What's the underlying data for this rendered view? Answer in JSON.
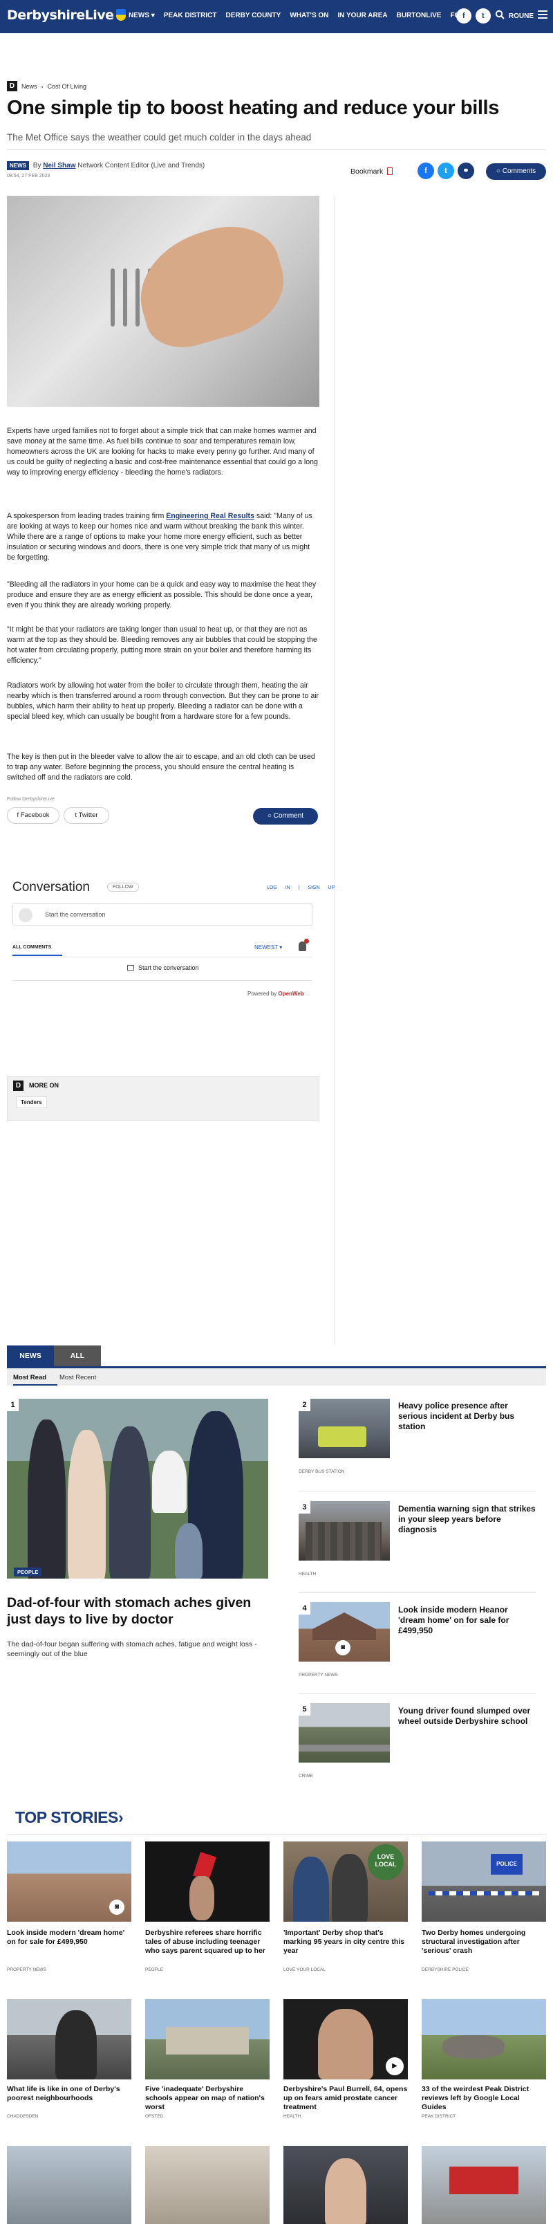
{
  "nav": {
    "logo": "DerbyshireLive",
    "links": [
      "NEWS ▾",
      "PEAK DISTRICT",
      "DERBY COUNTY",
      "WHAT'S ON",
      "IN YOUR AREA",
      "BURTONLIVE",
      "FO"
    ],
    "icons": [
      "facebook-icon",
      "twitter-icon",
      "search-icon"
    ],
    "account_label": "ROUNE"
  },
  "breadcrumb": {
    "items": [
      "News",
      "Cost Of Living"
    ]
  },
  "article": {
    "title": "One simple tip to boost heating and reduce your bills",
    "subtitle": "The Met Office says the weather could get much colder in the days ahead",
    "badge": "NEWS",
    "by": "By",
    "author": "Neil Shaw",
    "role": "Network Content Editor (Live and Trends)",
    "date": "08:54, 27 FEB 2023",
    "bookmark": "Bookmark",
    "comments_btn": "Comments",
    "p1": "Experts have urged families not to forget about a simple trick that can make homes warmer and save money at the same time. As fuel bills continue to soar and temperatures remain low, homeowners across the UK are looking for hacks to make every penny go further. And many of us could be guilty of neglecting a basic and cost-free maintenance essential that could go a long way to improving energy efficiency - bleeding the home's radiators.",
    "p2a": "A spokesperson from leading trades training firm ",
    "p2link": "Engineering Real Results",
    "p2b": " said: \"Many of us are looking at ways to keep our homes nice and warm without breaking the bank this winter. While there are a range of options to make your home more energy efficient, such as better insulation or securing windows and doors, there is one very simple trick that many of us might be forgetting.",
    "p3": "\"Bleeding all the radiators in your home can be a quick and easy way to maximise the heat they produce and ensure they are as energy efficient as possible. This should be done once a year, even if you think they are already working properly.",
    "p4": "\"It might be that your radiators are taking longer than usual to heat up, or that they are not as warm at the top as they should be. Bleeding removes any air bubbles that could be stopping the hot water from circulating properly, putting more strain on your boiler and therefore harming its efficiency.\"",
    "p5": "Radiators work by allowing hot water from the boiler to circulate through them, heating the air nearby which is then transferred around a room through convection. But they can be prone to air bubbles, which harm their ability to heat up properly. Bleeding a radiator can be done with a special bleed key, which can usually be bought from a hardware store for a few pounds.",
    "p6": "The key is then put in the bleeder valve to allow the air to escape, and an old cloth can be used to trap any water. Before beginning the process, you should ensure the central heating is switched off and the radiators are cold.",
    "follow": "Follow DerbyshireLive",
    "share_facebook": "Facebook",
    "share_twitter": "Twitter",
    "comment_btn": "Comment"
  },
  "conversation": {
    "title": "Conversation",
    "follow": "FOLLOW",
    "login": "LOG IN",
    "signup": "SIGN UP",
    "placeholder": "Start the conversation",
    "all_comments": "ALL COMMENTS",
    "sort": "NEWEST ▾",
    "start": "Start the conversation",
    "powered": "Powered by",
    "brand": "OpenWeb"
  },
  "more_on": {
    "label": "MORE ON",
    "tag": "Tenders"
  },
  "tabs": [
    "NEWS",
    "ALL"
  ],
  "subtabs": [
    "Most Read",
    "Most Recent"
  ],
  "most_read": {
    "main": {
      "num": "1",
      "cat": "PEOPLE",
      "title": "Dad-of-four with stomach aches given just days to live by doctor",
      "desc": "The dad-of-four began suffering with stomach aches, fatigue and weight loss - seemingly out of the blue"
    },
    "items": [
      {
        "num": "2",
        "title": "Heavy police presence after serious incident at Derby bus station",
        "cat": "DERBY BUS STATION"
      },
      {
        "num": "3",
        "title": "Dementia warning sign that strikes in your sleep years before diagnosis",
        "cat": "HEALTH"
      },
      {
        "num": "4",
        "title": "Look inside modern Heanor 'dream home' on for sale for £499,950",
        "cat": "PROPERTY NEWS"
      },
      {
        "num": "5",
        "title": "Young driver found slumped over wheel outside Derbyshire school",
        "cat": "CRIME"
      }
    ]
  },
  "top_stories": {
    "heading": "TOP STORIES",
    "arrow": "›",
    "row1": [
      {
        "title": "Look inside modern 'dream home' on for sale for £499,950",
        "cat": "PROPERTY NEWS"
      },
      {
        "title": "Derbyshire referees share horrific tales of abuse including teenager who says parent squared up to her",
        "cat": "PEOPLE"
      },
      {
        "title": "'Important' Derby shop that's marking 95 years in city centre this year",
        "cat": "LOVE YOUR LOCAL"
      },
      {
        "title": "Two Derby homes undergoing structural investigation after 'serious' crash",
        "cat": "DERBYSHIRE POLICE"
      }
    ],
    "row2": [
      {
        "title": "What life is like in one of Derby's poorest neighbourhoods",
        "cat": "CHADDESDEN"
      },
      {
        "title": "Five 'inadequate' Derbyshire schools appear on map of nation's worst",
        "cat": "OFSTED"
      },
      {
        "title": "Derbyshire's Paul Burrell, 64, opens up on fears amid prostate cancer treatment",
        "cat": "HEALTH"
      },
      {
        "title": "33 of the weirdest Peak District reviews left by Google Local Guides",
        "cat": "PEAK DISTRICT"
      }
    ],
    "love_local": "LOVE LOCAL",
    "police_sign": "POLICE"
  },
  "colors": {
    "brand": "#1b3a7a",
    "accent": "#c7292a",
    "facebook": "#1877f2",
    "twitter": "#1da1f2"
  }
}
